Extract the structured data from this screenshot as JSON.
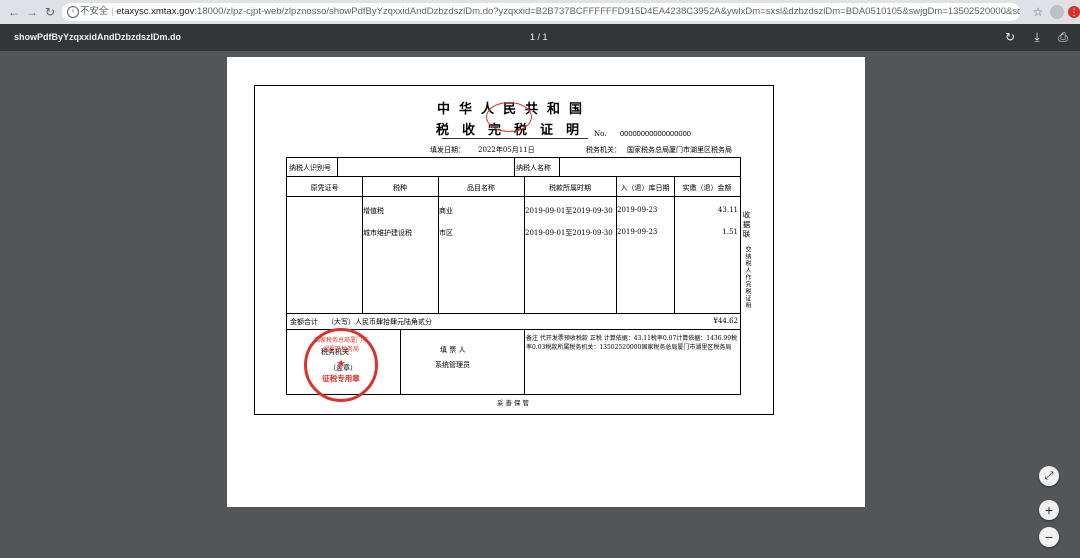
{
  "browser": {
    "security_label": "不安全",
    "url_host": "etaxysc.xmtax.gov",
    "url_rest": ":18000/zlpz-cjpt-web/zlpznosso/showPdfByYzqxxidAndDzbzdszlDm.do?yzqxxid=B2B737BCFFFFFFD915D4EA4238C3952A&ywlxDm=sxsl&dzbzdszlDm=BDA0510105&swjgDm=13502520000&sqbBz=N&useFop=Y&ywb..."
  },
  "pdf_toolbar": {
    "title": "showPdfByYzqxxidAndDzbzdszlDm.do",
    "page_indicator": "1 / 1"
  },
  "document": {
    "title": "中华人民共和国",
    "subtitle": "税收完税证明",
    "no_label": "No.",
    "no_value": "00000000000000000",
    "issue_date_label": "填发日期：",
    "issue_date_value": "2022年05月11日",
    "tax_authority_label": "税务机关：",
    "tax_authority_value": "国家税务总局厦门市湖里区税务局",
    "taxpayer_id_label": "纳税人识别号",
    "taxpayer_name_label": "纳税人名称",
    "columns": [
      "原凭证号",
      "税种",
      "品目名称",
      "税款所属时期",
      "入（退）库日期",
      "实缴（退）金额"
    ],
    "rows": [
      {
        "tax_type": "增值税",
        "item": "商业",
        "period": "2019-09-01至2019-09-30",
        "date": "2019-09-23",
        "amount": "43.11"
      },
      {
        "tax_type": "城市维护建设税",
        "item": "市区",
        "period": "2019-09-01至2019-09-30",
        "date": "2019-09-23",
        "amount": "1.51"
      }
    ],
    "total_label": "金额合计",
    "total_words": "（大写）人民币肆拾肆元陆角贰分",
    "total_amount": "¥44.62",
    "tax_office_label": "税务机关",
    "seal_note": "（盖章）",
    "filler_label": "填 票 人",
    "filler_name": "系统管理员",
    "remark": "备注 代开发票预收税款 正税  计算依据：43.11税率0.07计算依据：1436.99税率0.03税款所属税务机关：13502520000国家税务总局厦门市湖里区税务局",
    "side_copy": "收据联",
    "side_note": "交纳税人作完税证明",
    "footer": "妥善保管",
    "stamp_arc": "国家税务总局厦门市湖里区税务局",
    "stamp_center": "征税专用章"
  },
  "colors": {
    "stamp_red": "#d9342b",
    "viewer_bg": "#525659",
    "toolbar_bg": "#323639"
  }
}
